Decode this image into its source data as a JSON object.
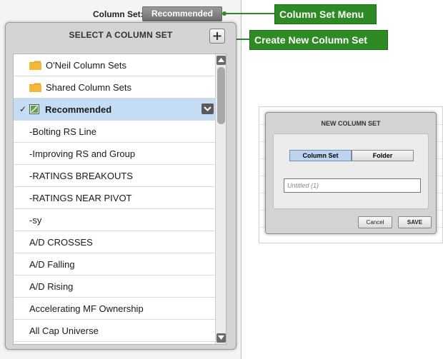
{
  "header": {
    "column_set_label": "Column Set:",
    "column_set_value": "Recommended"
  },
  "callouts": {
    "menu": "Column Set Menu",
    "create": "Create New Column Set"
  },
  "panel": {
    "title": "SELECT A COLUMN SET",
    "add_symbol": "+",
    "items": [
      {
        "label": "O'Neil Column Sets",
        "type": "folder"
      },
      {
        "label": "Shared Column Sets",
        "type": "folder"
      },
      {
        "label": "Recommended",
        "type": "selected",
        "check": "✓"
      },
      {
        "label": "-Bolting RS Line"
      },
      {
        "label": "-Improving RS and Group"
      },
      {
        "label": "-RATINGS BREAKOUTS"
      },
      {
        "label": "-RATINGS NEAR PIVOT"
      },
      {
        "label": "-sy"
      },
      {
        "label": "A/D CROSSES"
      },
      {
        "label": "A/D Falling"
      },
      {
        "label": "A/D Rising"
      },
      {
        "label": "Accelerating MF Ownership"
      },
      {
        "label": "All Cap Universe"
      }
    ]
  },
  "dialog": {
    "title": "NEW COLUMN SET",
    "segment_column_set": "Column Set",
    "segment_folder": "Folder",
    "name_placeholder": "Untitled (1)",
    "cancel_label": "Cancel",
    "save_label": "SAVE"
  },
  "colors": {
    "callout_green": "#2e8b23",
    "selected_row": "#c5dcf5",
    "folder_yellow": "#e8a92a"
  }
}
